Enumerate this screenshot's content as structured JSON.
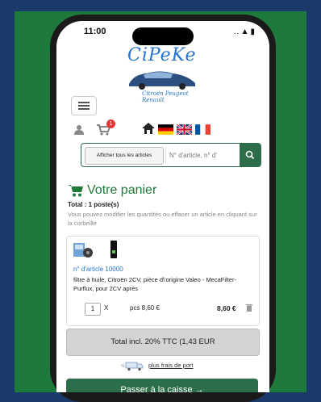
{
  "status": {
    "time": "11:00",
    "icons": "‥ ▲ ▮"
  },
  "logo": {
    "title": "CiPeKe",
    "subtitle": "Citroën Peugeot Renault"
  },
  "search": {
    "all_articles_label": "Afficher tous les articles",
    "placeholder": "N° d'article, n° d'"
  },
  "cart": {
    "badge": "1",
    "title": "Votre panier",
    "total_items": "Total : 1 poste(s)",
    "hint": "Vous pouvez modifier les quantités ou effacer un article en cliquant sur la corbeille"
  },
  "item": {
    "article_no": "n° d'article 10000",
    "description": "filtre à huile, Citroën 2CV, pièce d\\'origine Valeo - MecaFilter-Purflux, pour 2CV après",
    "quantity": "1",
    "x": "X",
    "unit_price": "pcs 8,60 €",
    "line_total": "8,60 €"
  },
  "summary": {
    "total": "Total incl. 20% TTC (1,43 EUR",
    "shipping_link": "plus frais de port",
    "checkout": "Passer à la caisse →"
  },
  "colors": {
    "brand_green": "#2c6e49",
    "title_green": "#1f7a3a",
    "link_blue": "#2a74c8",
    "badge_red": "#e53935"
  }
}
